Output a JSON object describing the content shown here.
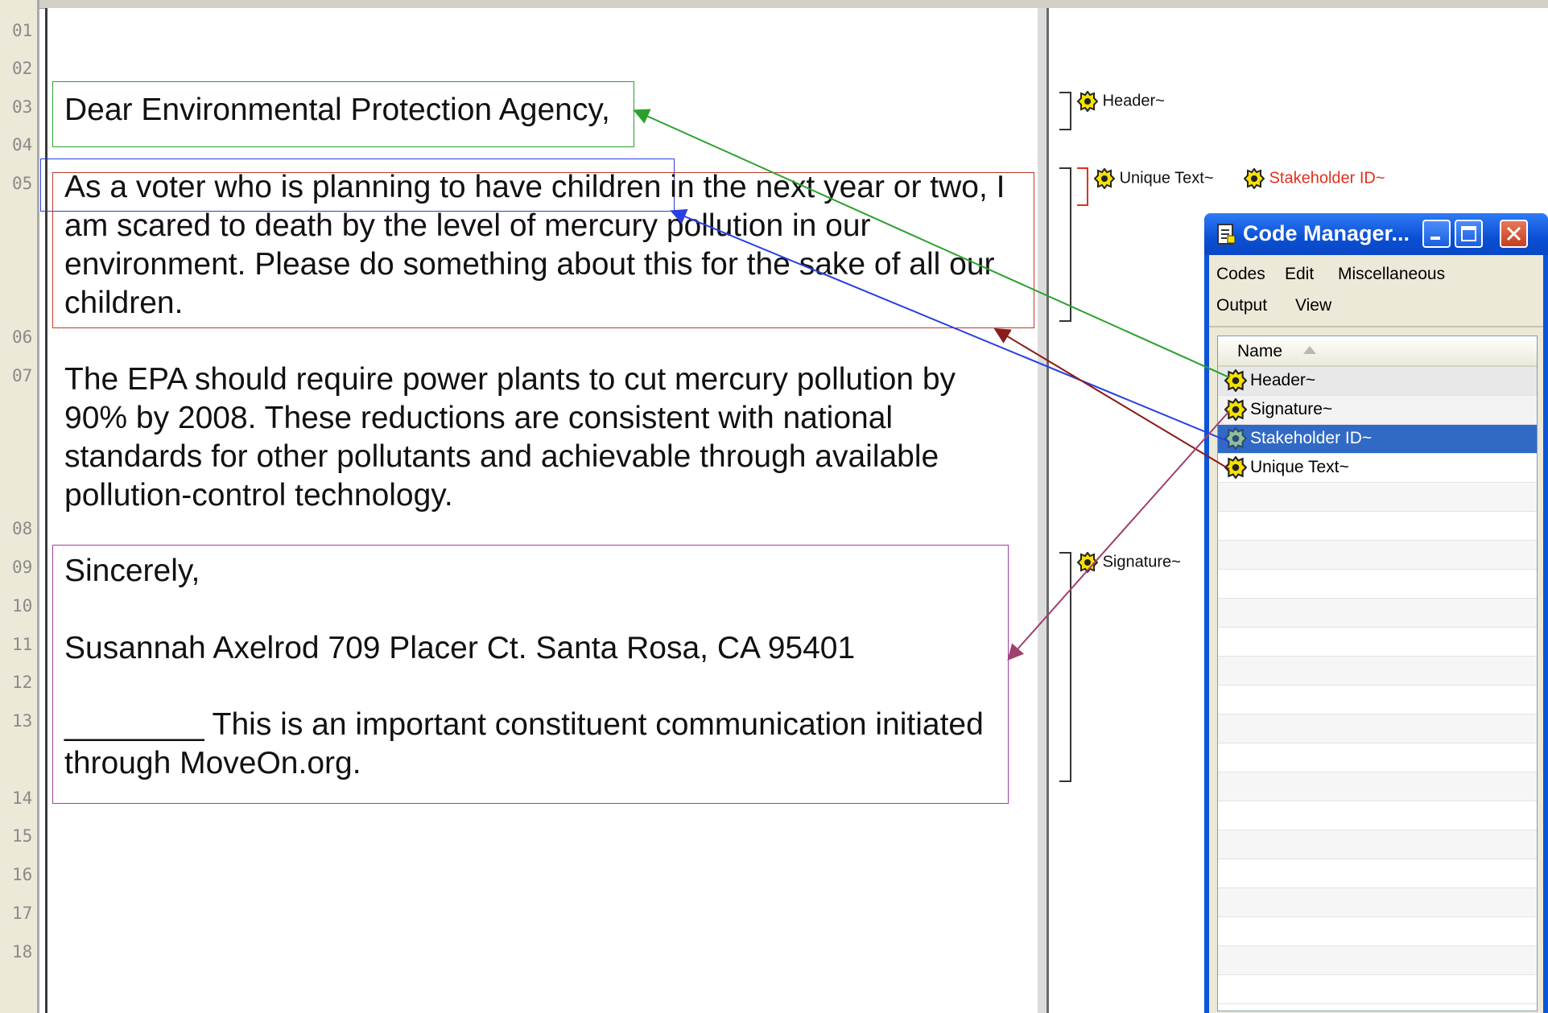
{
  "line_numbers": [
    "01",
    "02",
    "03",
    "04",
    "05",
    "06",
    "07",
    "08",
    "09",
    "10",
    "11",
    "12",
    "13",
    "14",
    "15",
    "16",
    "17",
    "18"
  ],
  "document": {
    "header": "Dear Environmental Protection Agency,",
    "unique_text": [
      "As a voter who is planning to have children in the next year or two, I",
      "am scared to death by the level of mercury pollution in our",
      "environment. Please do something about this for the sake of all our",
      "children."
    ],
    "paragraph2": [
      "The EPA should require power plants to cut mercury pollution by",
      "90% by 2008. These reductions are consistent with national",
      "standards for other pollutants and achievable through available",
      "pollution-control technology."
    ],
    "signature": [
      "Sincerely,",
      "Susannah Axelrod 709 Placer Ct. Santa Rosa, CA  95401",
      "________ This is an important constituent communication initiated",
      "through  MoveOn.org."
    ]
  },
  "margin_codes": {
    "header": "Header~",
    "unique_text": "Unique Text~",
    "stakeholder_id": "Stakeholder ID~",
    "signature": "Signature~"
  },
  "code_manager": {
    "title": "Code Manager...",
    "menu": [
      "Codes",
      "Edit",
      "Miscellaneous",
      "Output",
      "View"
    ],
    "column_header": "Name",
    "items": [
      "Header~",
      "Signature~",
      "Stakeholder ID~",
      "Unique Text~"
    ],
    "selected_item": "Stakeholder ID~"
  },
  "colors": {
    "header_box": "#2ca02c",
    "stakeholder_box": "#2a3fe0",
    "unique_box": "#c0392b",
    "signature_box": "#a040a0",
    "stakeholder_label": "#e0301e",
    "selection": "#316ac5"
  },
  "icons": {
    "code": "code-gear-icon",
    "window": "code-manager-window-icon",
    "sort": "sort-ascending-icon"
  }
}
